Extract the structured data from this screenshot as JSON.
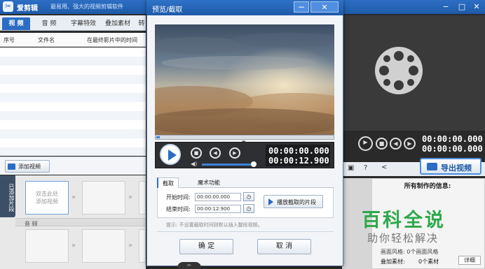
{
  "app": {
    "logo_glyph": "✂",
    "name": "爱剪辑",
    "slogan": "最易用、强大的视频剪辑软件",
    "min": "−",
    "max": "□",
    "close": "✕"
  },
  "tabs": [
    {
      "label": "视 频",
      "active": true
    },
    {
      "label": "音 频",
      "active": false
    },
    {
      "label": "字幕特效",
      "active": false
    },
    {
      "label": "叠加素材",
      "active": false
    },
    {
      "label": "转",
      "active": false
    }
  ],
  "list": {
    "col_index": "序号",
    "col_file": "文件名",
    "col_time": "在最终影片中的时间"
  },
  "add_video_label": "添加视频",
  "timeline": {
    "side_label": "已添加片段",
    "first_slot_text_1": "双击此处",
    "first_slot_text_2": "添加视频",
    "audio_label": "音 频"
  },
  "right": {
    "timer_top": "00:00:00.000",
    "timer_bottom": "00:00:00.000",
    "export_label": "导出视频",
    "info_title": "所有制作的信息:",
    "info_row1": "画面风格:  0个画面风格",
    "info_row2_label": "叠加素材:",
    "info_row2_value": "0个素材",
    "detail_label": "详细"
  },
  "dialog": {
    "title": "预览/截取",
    "min": "−",
    "close": "✕",
    "progress_fraction": 0.02,
    "timer_current": "00:00:00.000",
    "timer_total": "00:00:12.900",
    "tabs": [
      "截取",
      "魔术功能"
    ],
    "start_label": "开始时间:",
    "start_value": "00:00:00.000",
    "end_label": "结束时间:",
    "end_value": "00:00:12.900",
    "play_clip_label": "播放截取的片段",
    "hint": "提示: 不设置截取时间则默认插入整段视频。",
    "ok_label": "确 定",
    "cancel_label": "取 消"
  },
  "watermark": {
    "title": "百科全说",
    "subtitle": "助你轻松解决"
  }
}
